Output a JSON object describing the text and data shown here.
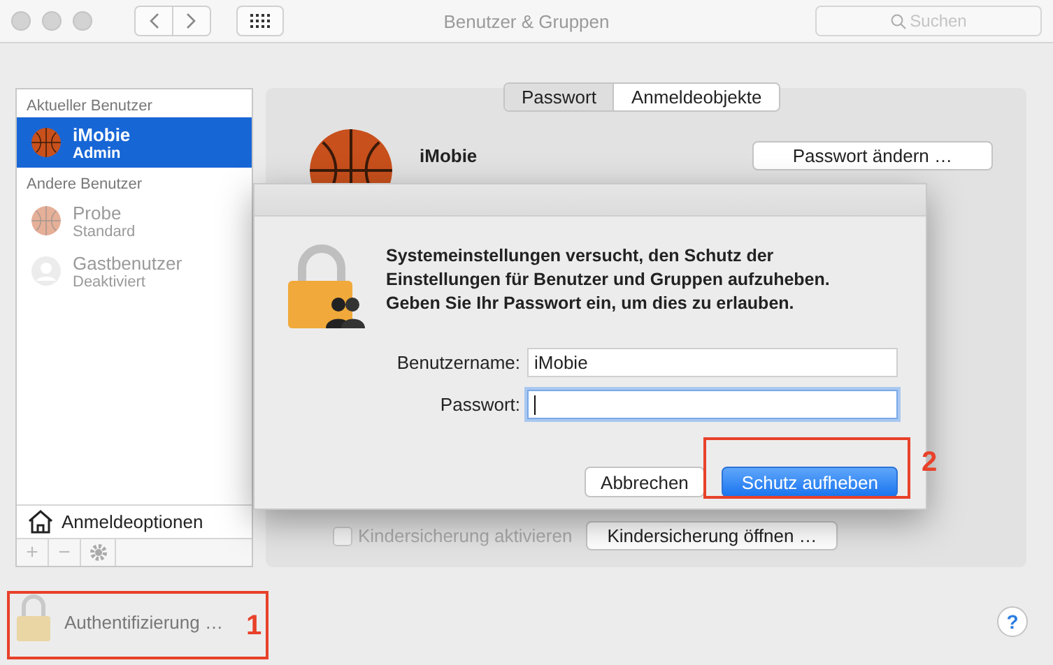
{
  "window": {
    "title": "Benutzer & Gruppen"
  },
  "search": {
    "placeholder": "Suchen"
  },
  "sidebar": {
    "sections": [
      {
        "header": "Aktueller Benutzer",
        "users": [
          {
            "name": "iMobie",
            "role": "Admin",
            "kind": "user",
            "selected": true,
            "disabled": false
          }
        ]
      },
      {
        "header": "Andere Benutzer",
        "users": [
          {
            "name": "Probe",
            "role": "Standard",
            "kind": "user",
            "selected": false,
            "disabled": true
          },
          {
            "name": "Gastbenutzer",
            "role": "Deaktiviert",
            "kind": "guest",
            "selected": false,
            "disabled": true
          }
        ]
      }
    ],
    "login_options": "Anmeldeoptionen",
    "list_buttons": [
      "+",
      "−"
    ]
  },
  "tabs": [
    {
      "label": "Passwort",
      "selected": true
    },
    {
      "label": "Anmeldeobjekte",
      "selected": false
    }
  ],
  "user_panel": {
    "name": "iMobie",
    "button": "Passwort ändern …"
  },
  "parental": {
    "checkbox": {
      "label": "Kindersicherung aktivieren",
      "checked": false,
      "disabled": true
    },
    "button": "Kindersicherung öffnen …"
  },
  "dialog": {
    "message": "Systemeinstellungen versucht, den Schutz der Einstellungen für Benutzer und Gruppen aufzuheben. Geben Sie Ihr Passwort ein, um dies zu erlauben.",
    "fields": [
      {
        "label": "Benutzername:",
        "value": "iMobie",
        "focused": false
      },
      {
        "label": "Passwort:",
        "focused": true
      }
    ],
    "buttons": [
      {
        "label": "Abbrechen",
        "default": false
      },
      {
        "label": "Schutz aufheben",
        "default": true
      }
    ]
  },
  "bottom": {
    "lock_label": "Authentifizierung …",
    "help": "?"
  },
  "annotations": [
    {
      "label": "1"
    },
    {
      "label": "2"
    }
  ]
}
